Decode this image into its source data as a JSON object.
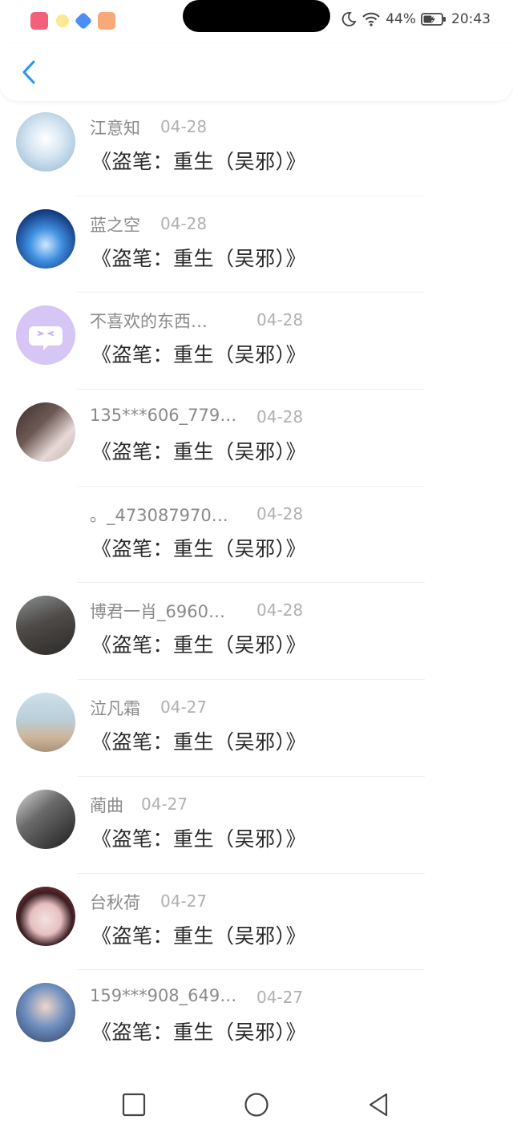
{
  "status_bar": {
    "battery": "44%",
    "time": "20:43",
    "icons": [
      "app-notification-icon",
      "app-notification-icon",
      "app-notification-icon",
      "app-notification-icon",
      "moon-icon",
      "wifi-icon",
      "battery-icon"
    ]
  },
  "header": {
    "back_icon": "chevron-left-icon",
    "accent_color": "#2196f3"
  },
  "items": [
    {
      "name": "江意知",
      "date": "04-28",
      "title": "《盗笔：重生（吴邪）》"
    },
    {
      "name": "蓝之空",
      "date": "04-28",
      "title": "《盗笔：重生（吴邪）》"
    },
    {
      "name": "不喜欢的东西…",
      "date": "04-28",
      "title": "《盗笔：重生（吴邪）》"
    },
    {
      "name": "135***606_779…",
      "date": "04-28",
      "title": "《盗笔：重生（吴邪）》"
    },
    {
      "name": "。_473087970…",
      "date": "04-28",
      "title": "《盗笔：重生（吴邪）》"
    },
    {
      "name": "博君一肖_6960…",
      "date": "04-28",
      "title": "《盗笔：重生（吴邪）》"
    },
    {
      "name": "泣凡霜",
      "date": "04-27",
      "title": "《盗笔：重生（吴邪）》"
    },
    {
      "name": "蔺曲",
      "date": "04-27",
      "title": "《盗笔：重生（吴邪）》"
    },
    {
      "name": "台秋荷",
      "date": "04-27",
      "title": "《盗笔：重生（吴邪）》"
    },
    {
      "name": "159***908_649…",
      "date": "04-27",
      "title": "《盗笔：重生（吴邪）》"
    }
  ],
  "nav_bar": {
    "icons": [
      "recent-apps-icon",
      "home-icon",
      "back-triangle-icon"
    ]
  }
}
